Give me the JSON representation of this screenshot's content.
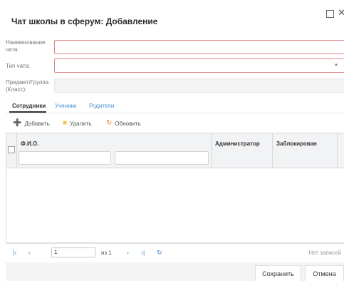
{
  "window": {
    "title": "Чат школы в сферум: Добавление",
    "maximize_icon": "maximize-icon",
    "close_icon": "close-icon"
  },
  "form": {
    "name_label": "Наименование чата:",
    "name_value": "",
    "type_label": "Тип чата:",
    "type_value": "",
    "subject_label": "Предмет/Группа (Класс):",
    "subject_value": ""
  },
  "tabs": [
    {
      "label": "Сотрудники",
      "active": true
    },
    {
      "label": "Ученики",
      "active": false
    },
    {
      "label": "Родители",
      "active": false
    }
  ],
  "toolbar": {
    "add_label": "Добавить",
    "add_icon": "add-user-icon",
    "delete_label": "Удалить",
    "delete_icon": "trash-icon",
    "refresh_label": "Обновить",
    "refresh_icon": "refresh-icon"
  },
  "grid": {
    "columns": [
      "Ф.И.О.",
      "Администратор",
      "Заблокирован"
    ],
    "rows": []
  },
  "pager": {
    "page_value": "1",
    "of_label": "из 1",
    "status": "Нет записей"
  },
  "footer": {
    "save_label": "Сохранить",
    "cancel_label": "Отмена"
  },
  "colors": {
    "accent": "#4a8fd0",
    "required_border": "#e08585",
    "add_icon": "#f0a030",
    "delete_icon": "#f5c04a",
    "refresh_icon": "#f08030"
  }
}
